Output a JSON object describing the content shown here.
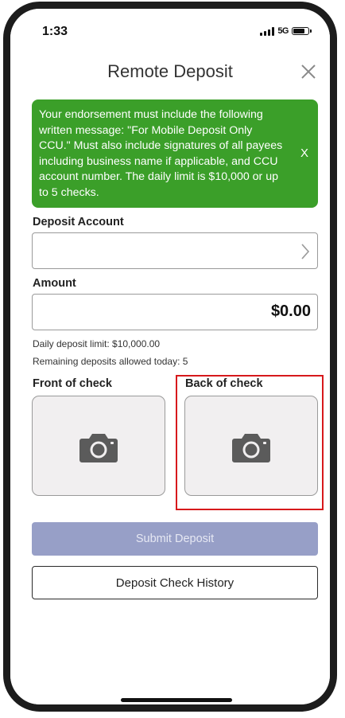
{
  "status_bar": {
    "time": "1:33",
    "network": "5G",
    "icons": [
      "signal-icon",
      "battery-icon"
    ]
  },
  "header": {
    "title": "Remote Deposit",
    "close_icon": "close-icon"
  },
  "notice": {
    "message": "Your endorsement must include the following written message: \"For Mobile Deposit Only CCU.\" Must also include signatures of all payees including business name if applicable, and CCU account number. The daily limit is $10,000 or up to 5 checks.",
    "dismiss_label": "X",
    "background_color": "#3b9f29"
  },
  "form": {
    "deposit_account": {
      "label": "Deposit Account",
      "value": "",
      "icon": "chevron-right-icon"
    },
    "amount": {
      "label": "Amount",
      "value": "$0.00"
    },
    "daily_limit": "Daily deposit limit: $10,000.00",
    "remaining": "Remaining deposits allowed today: 5"
  },
  "checks": {
    "front": {
      "label": "Front of check",
      "icon": "camera-icon"
    },
    "back": {
      "label": "Back of check",
      "icon": "camera-icon",
      "highlighted": true,
      "highlight_color": "#d7191c"
    }
  },
  "actions": {
    "submit_label": "Submit Deposit",
    "submit_enabled": false,
    "submit_color": "#979fc7",
    "history_label": "Deposit Check History"
  }
}
